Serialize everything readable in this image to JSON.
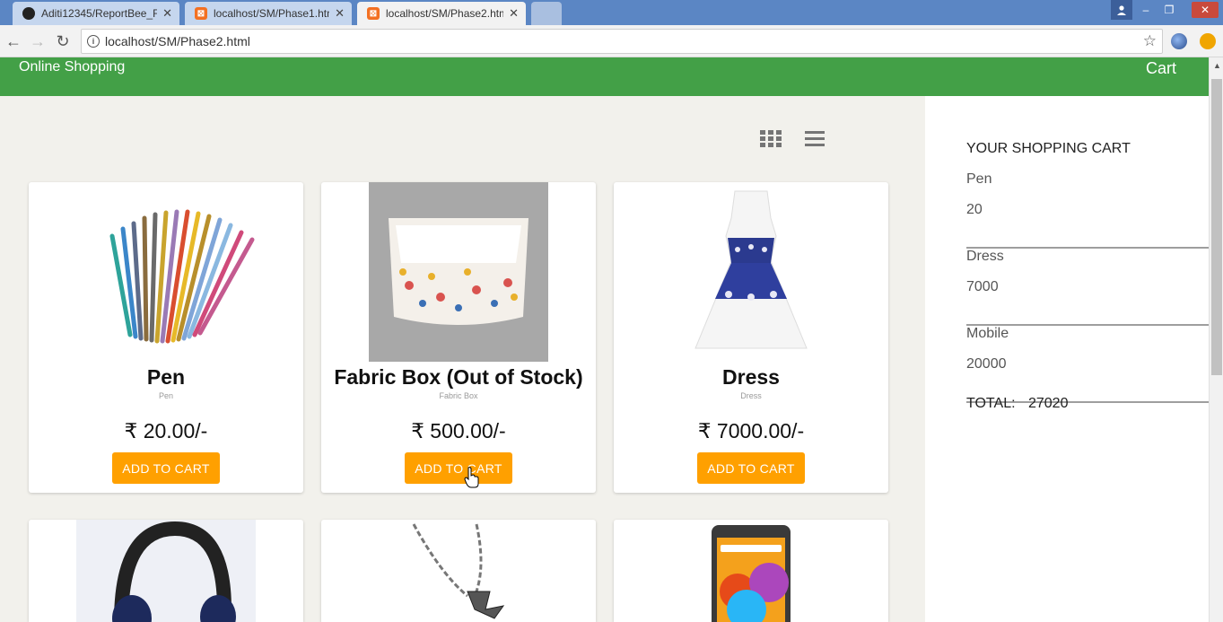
{
  "browser": {
    "tabs": [
      {
        "label": "Aditi12345/ReportBee_F",
        "icon": "github-icon",
        "active": false
      },
      {
        "label": "localhost/SM/Phase1.htm",
        "icon": "xampp-icon",
        "active": false
      },
      {
        "label": "localhost/SM/Phase2.htm",
        "icon": "xampp-icon",
        "active": true
      }
    ],
    "url": "localhost/SM/Phase2.html"
  },
  "header": {
    "title": "Online Shopping",
    "cart_link": "Cart"
  },
  "products": [
    {
      "name": "Pen",
      "subtitle": "Pen",
      "price": "₹ 20.00/-",
      "button": "ADD TO CART"
    },
    {
      "name": "Fabric Box (Out of Stock)",
      "subtitle": "Fabric Box",
      "price": "₹ 500.00/-",
      "button": "ADD TO CART"
    },
    {
      "name": "Dress",
      "subtitle": "Dress",
      "price": "₹ 7000.00/-",
      "button": "ADD TO CART"
    }
  ],
  "lower_products_icons": [
    "headphones-image",
    "necklace-image",
    "mobile-image"
  ],
  "cart": {
    "title": "YOUR SHOPPING CART",
    "items": [
      {
        "name": "Pen",
        "price": "20"
      },
      {
        "name": "Dress",
        "price": "7000"
      },
      {
        "name": "Mobile",
        "price": "20000"
      }
    ],
    "total_label": "TOTAL:",
    "total_value": "27020"
  },
  "colors": {
    "header": "#43a047",
    "button": "#ffa000",
    "tabstrip": "#5b86c4"
  }
}
